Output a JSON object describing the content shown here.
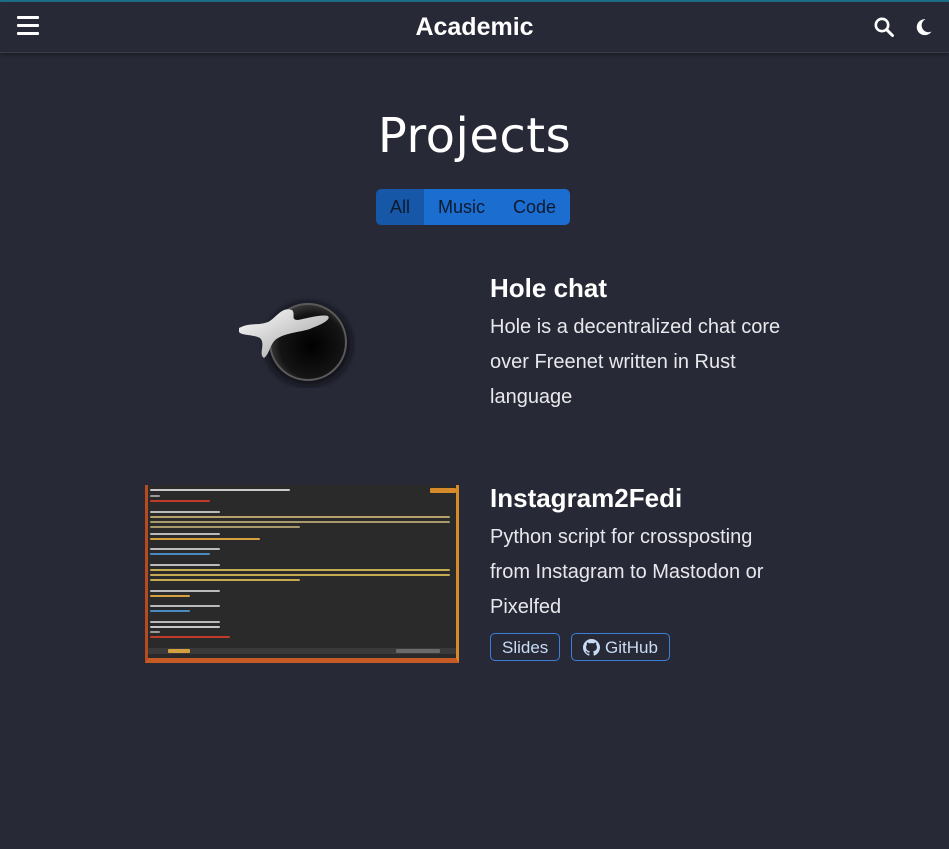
{
  "navbar": {
    "brand": "Academic",
    "menu_icon": "hamburger-menu-icon",
    "search_icon": "search-icon",
    "theme_icon": "moon-icon"
  },
  "page": {
    "title": "Projects"
  },
  "filters": [
    {
      "label": "All",
      "active": true
    },
    {
      "label": "Music",
      "active": false
    },
    {
      "label": "Code",
      "active": false
    }
  ],
  "projects": [
    {
      "title": "Hole chat",
      "description_lines": [
        "Hole is a decentralized chat core",
        "over Freenet written in Rust",
        "language"
      ],
      "image": "hole-logo"
    },
    {
      "title": "Instagram2Fedi",
      "description_lines": [
        "Python script for crossposting",
        "from Instagram to Mastodon or",
        "Pixelfed"
      ],
      "image": "terminal-screenshot",
      "buttons": [
        {
          "label": "Slides",
          "icon": ""
        },
        {
          "label": "GitHub",
          "icon": "github-icon"
        }
      ]
    }
  ],
  "colors": {
    "background": "#272a36",
    "accent": "#1c6dd0",
    "accent_active": "#1657a8"
  }
}
